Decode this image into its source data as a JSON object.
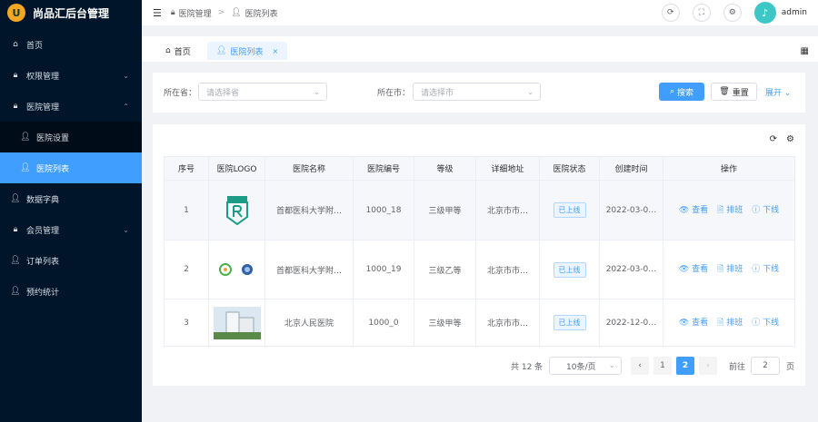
{
  "brand": {
    "logo_letter": "U",
    "title": "尚品汇后台管理"
  },
  "sidebar": {
    "items": [
      {
        "label": "首页",
        "icon": "home-icon"
      },
      {
        "label": "权限管理",
        "icon": "lock-icon",
        "arrow": "⌄"
      },
      {
        "label": "医院管理",
        "icon": "lock-icon",
        "arrow": "⌃"
      },
      {
        "label": "医院设置",
        "icon": "user-icon"
      },
      {
        "label": "医院列表",
        "icon": "user-icon"
      },
      {
        "label": "数据字典",
        "icon": "user-icon"
      },
      {
        "label": "会员管理",
        "icon": "lock-icon",
        "arrow": "⌄"
      },
      {
        "label": "订单列表",
        "icon": "user-icon"
      },
      {
        "label": "预约统计",
        "icon": "user-icon"
      }
    ]
  },
  "header": {
    "breadcrumb": [
      "医院管理",
      "医院列表"
    ],
    "username": "admin"
  },
  "tabs": [
    {
      "label": "首页"
    },
    {
      "label": "医院列表"
    }
  ],
  "search": {
    "province_label": "所在省：",
    "province_placeholder": "请选择省",
    "city_label": "所在市：",
    "city_placeholder": "请选择市",
    "search_label": "搜索",
    "reset_label": "重置",
    "expand_label": "展开"
  },
  "table": {
    "headers": [
      "序号",
      "医院LOGO",
      "医院名称",
      "医院编号",
      "等级",
      "详细地址",
      "医院状态",
      "创建时间",
      "操作"
    ],
    "rows": [
      {
        "index": "1",
        "name": "首都医科大学附…",
        "code": "1000_18",
        "level": "三级甲等",
        "address": "北京市市…",
        "status": "已上线",
        "created": "2022-03-0…"
      },
      {
        "index": "2",
        "name": "首都医科大学附…",
        "code": "1000_19",
        "level": "三级乙等",
        "address": "北京市市…",
        "status": "已上线",
        "created": "2022-03-0…"
      },
      {
        "index": "3",
        "name": "北京人民医院",
        "code": "1000_0",
        "level": "三级甲等",
        "address": "北京市市…",
        "status": "已上线",
        "created": "2022-12-0…"
      }
    ],
    "ops": {
      "view": "查看",
      "schedule": "排班",
      "offline": "下线"
    }
  },
  "pager": {
    "total_text": "共 12 条",
    "page_size": "10条/页",
    "pages": [
      "1",
      "2"
    ],
    "current_page": "2",
    "goto_label": "前往",
    "goto_value": "2",
    "page_unit": "页"
  },
  "colors": {
    "primary": "#409eff",
    "sidebar_bg": "#001529",
    "active_menu": "#409eff"
  }
}
